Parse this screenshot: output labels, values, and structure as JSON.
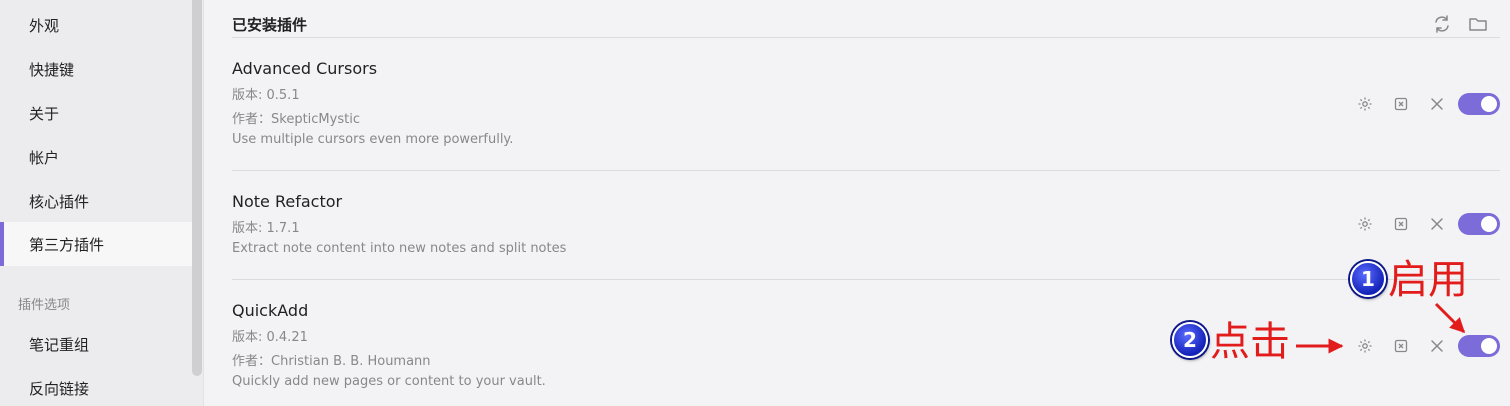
{
  "sidebar": {
    "items": [
      {
        "label": "外观"
      },
      {
        "label": "快捷键"
      },
      {
        "label": "关于"
      },
      {
        "label": "帐户"
      },
      {
        "label": "核心插件"
      },
      {
        "label": "第三方插件",
        "active": true
      }
    ],
    "section_label": "插件选项",
    "option_items": [
      {
        "label": "笔记重组"
      },
      {
        "label": "反向链接"
      }
    ]
  },
  "main": {
    "title": "已安装插件",
    "header_icons": [
      "refresh-icon",
      "folder-icon"
    ]
  },
  "plugins": [
    {
      "name": "Advanced Cursors",
      "version": "版本: 0.5.1",
      "author": "作者：SkepticMystic",
      "description": "Use multiple cursors even more powerfully.",
      "enabled": true
    },
    {
      "name": "Note Refactor",
      "version": "版本: 1.7.1",
      "author": "",
      "description": "Extract note content into new notes and split notes",
      "enabled": true
    },
    {
      "name": "QuickAdd",
      "version": "版本: 0.4.21",
      "author": "作者：Christian B. B. Houmann",
      "description": "Quickly add new pages or content to your vault.",
      "enabled": true
    }
  ],
  "annotations": {
    "step1_number": "1",
    "step1_label": "启用",
    "step2_number": "2",
    "step2_label": "点击"
  },
  "colors": {
    "accent": "#7b6cd9",
    "annotation_red": "#e21b1b",
    "badge_blue": "#1322b8"
  }
}
